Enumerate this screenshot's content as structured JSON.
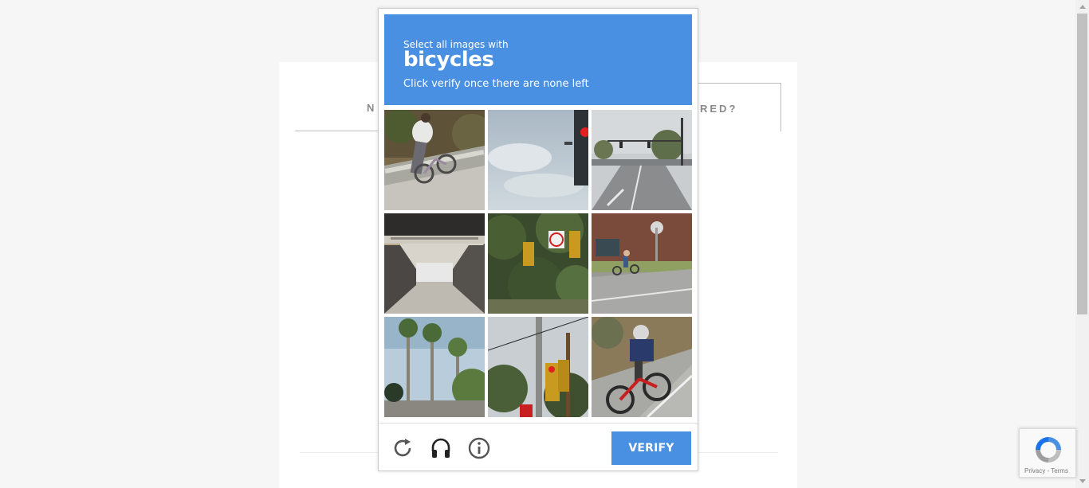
{
  "background": {
    "tab_left_text": "N",
    "tab_right_text": "RED?"
  },
  "captcha": {
    "instruction_line1": "Select all images with",
    "target_object": "bicycles",
    "instruction_line3": "Click verify once there are none left",
    "tiles": [
      {
        "id": 1,
        "label": "tile-1"
      },
      {
        "id": 2,
        "label": "tile-2"
      },
      {
        "id": 3,
        "label": "tile-3"
      },
      {
        "id": 4,
        "label": "tile-4"
      },
      {
        "id": 5,
        "label": "tile-5"
      },
      {
        "id": 6,
        "label": "tile-6"
      },
      {
        "id": 7,
        "label": "tile-7"
      },
      {
        "id": 8,
        "label": "tile-8"
      },
      {
        "id": 9,
        "label": "tile-9"
      }
    ],
    "footer": {
      "reload_icon": "reload-icon",
      "audio_icon": "headphones-icon",
      "info_icon": "info-icon",
      "verify_label": "VERIFY"
    },
    "accent_color": "#4a90e2"
  },
  "badge": {
    "links": "Privacy - Terms"
  }
}
